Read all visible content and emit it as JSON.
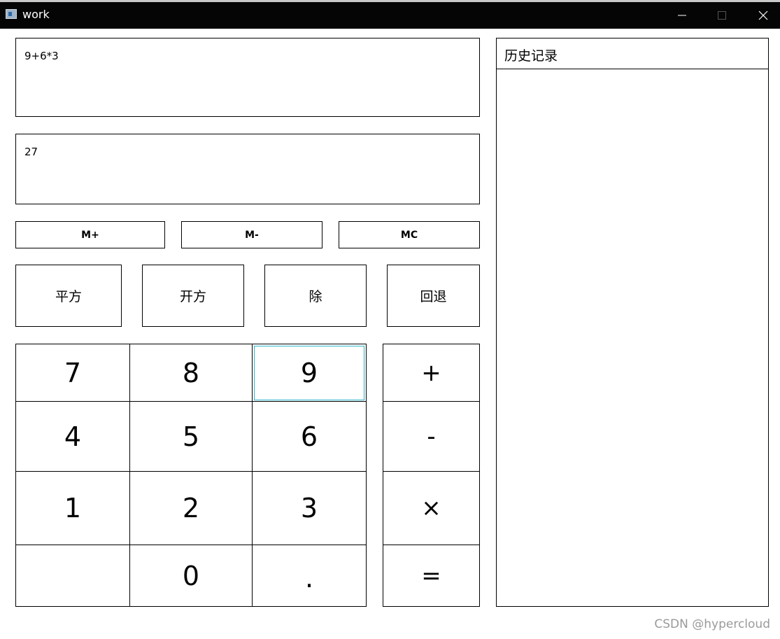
{
  "window": {
    "title": "work",
    "icon": "app-icon",
    "controls": {
      "minimize": "minimize-icon",
      "maximize": "maximize-icon",
      "close": "close-icon"
    }
  },
  "display": {
    "expression": "9+6*3",
    "result": "27"
  },
  "memory": {
    "m_plus": "M+",
    "m_minus": "M-",
    "mc": "MC"
  },
  "functions": {
    "square": "平方",
    "sqrt": "开方",
    "divide": "除",
    "backspace": "回退"
  },
  "keypad": {
    "k7": "7",
    "k8": "8",
    "k9": "9",
    "k4": "4",
    "k5": "5",
    "k6": "6",
    "k1": "1",
    "k2": "2",
    "k3": "3",
    "k0": "0",
    "dot": "."
  },
  "operators": {
    "plus": "+",
    "minus": "-",
    "times": "×",
    "equals": "="
  },
  "history": {
    "title": "历史记录"
  },
  "watermark": "CSDN @hypercloud",
  "colors": {
    "titlebar": "#050505",
    "focus": "#2ab5c9",
    "watermark": "#9a9a9a"
  }
}
